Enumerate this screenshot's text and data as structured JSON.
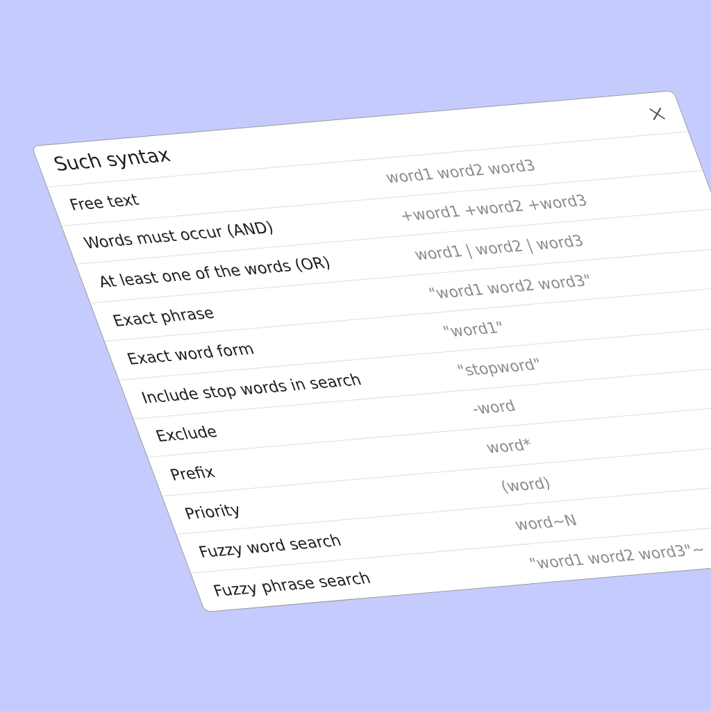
{
  "dialog": {
    "title": "Such syntax",
    "rows": [
      {
        "label": "Free text",
        "example": "word1 word2 word3"
      },
      {
        "label": "Words must occur (AND)",
        "example": "+word1 +word2 +word3"
      },
      {
        "label": "At least one of the words (OR)",
        "example": "word1 | word2 | word3"
      },
      {
        "label": "Exact phrase",
        "example": "\"word1 word2 word3\""
      },
      {
        "label": "Exact word form",
        "example": "\"word1\""
      },
      {
        "label": "Include stop words in search",
        "example": "\"stopword\""
      },
      {
        "label": "Exclude",
        "example": "-word"
      },
      {
        "label": "Prefix",
        "example": "word*"
      },
      {
        "label": "Priority",
        "example": "(word)"
      },
      {
        "label": "Fuzzy word search",
        "example": "word~N"
      },
      {
        "label": "Fuzzy phrase search",
        "example": "\"word1 word2 word3\"~"
      }
    ]
  }
}
